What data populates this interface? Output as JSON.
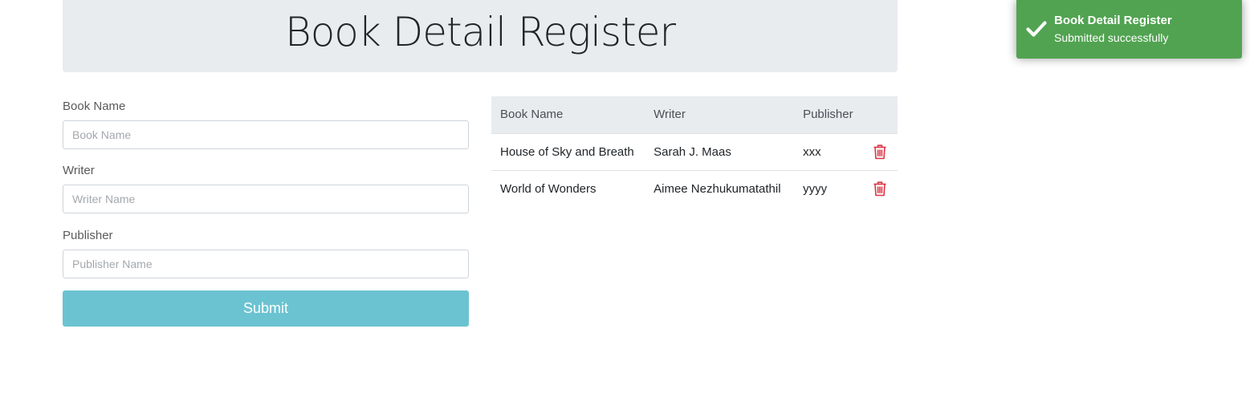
{
  "header": {
    "title": "Book Detail Register"
  },
  "form": {
    "book_name": {
      "label": "Book Name",
      "placeholder": "Book Name",
      "value": ""
    },
    "writer": {
      "label": "Writer",
      "placeholder": "Writer Name",
      "value": ""
    },
    "publisher": {
      "label": "Publisher",
      "placeholder": "Publisher Name",
      "value": ""
    },
    "submit_label": "Submit"
  },
  "table": {
    "columns": [
      "Book Name",
      "Writer",
      "Publisher"
    ],
    "rows": [
      {
        "book_name": "House of Sky and Breath",
        "writer": "Sarah J. Maas",
        "publisher": "xxx",
        "action_icon": "trash-icon"
      },
      {
        "book_name": "World of Wonders",
        "writer": "Aimee Nezhukumatathil",
        "publisher": "yyyy",
        "action_icon": "trash-icon"
      }
    ]
  },
  "toast": {
    "title": "Book Detail Register",
    "message": "Submitted successfully",
    "icon": "checkmark-icon",
    "color": "#51a351"
  },
  "colors": {
    "submit_button": "#6bc3d2",
    "delete_icon": "#dc3545",
    "jumbotron_bg": "#e9ecef"
  }
}
